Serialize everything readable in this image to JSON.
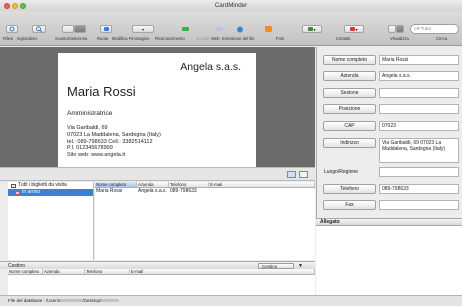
{
  "window": {
    "title": "CardMinder"
  },
  "toolbar": {
    "labels": [
      "Rilevi",
      "Ingrandisci",
      "Scostu/Seleziona",
      "Ruota",
      "Modifica Fimmagine",
      "Riconoscimento",
      "E-mail",
      "Web",
      "Emissione del file",
      "Foto",
      "Contatti",
      "Visualizza",
      "Cerca"
    ],
    "search_placeholder": "Tutto"
  },
  "card": {
    "company": "Angela s.a.s.",
    "name": "Maria Rossi",
    "role": "Amministratrice",
    "address_lines": [
      "Via Garibaldi, 69",
      "07023 La Maddalena, Sardegna (Italy)",
      "tel.: 089-798633    Cell.: 3382514112",
      "P.I. 012345678999",
      "Sito web: www.angela.it"
    ]
  },
  "groups": {
    "items": [
      {
        "label": "Tutti i biglietti da visita"
      },
      {
        "label": "In arrivo"
      }
    ]
  },
  "contacts_table": {
    "columns": [
      "Nome completo",
      "Azienda",
      "Telefono",
      "E-mail"
    ],
    "rows": [
      {
        "name": "Maria Rossi",
        "company": "Angela s.a.s.",
        "phone": "089-798633",
        "email": ""
      }
    ]
  },
  "trash": {
    "title": "Cestino",
    "button_label": "Cestino",
    "columns": [
      "Nome completo",
      "Azienda",
      "Telefono",
      "E-mail"
    ]
  },
  "status": {
    "prefix": "File del database : /Users/",
    "mid": "/Desktop/"
  },
  "form": {
    "fields": [
      {
        "label": "Nome completo",
        "value": "Maria Rossi"
      },
      {
        "label": "Azienda",
        "value": "Angela s.a.s."
      },
      {
        "label": "Sezione",
        "value": ""
      },
      {
        "label": "Posizione",
        "value": ""
      },
      {
        "label": "CAP",
        "value": "07023"
      },
      {
        "label": "Indirizzo",
        "value": "Via Garibaldi, 69 07023 La Maddalena, Sardegna (Italy)"
      },
      {
        "label": "Luogo/Regione",
        "value": ""
      },
      {
        "label": "Telefono",
        "value": "089-798633"
      },
      {
        "label": "Fax",
        "value": ""
      }
    ],
    "attachments_title": "Allegato"
  },
  "colors": {
    "selection": "#3a80d6",
    "stage": "#6c6c6c"
  }
}
